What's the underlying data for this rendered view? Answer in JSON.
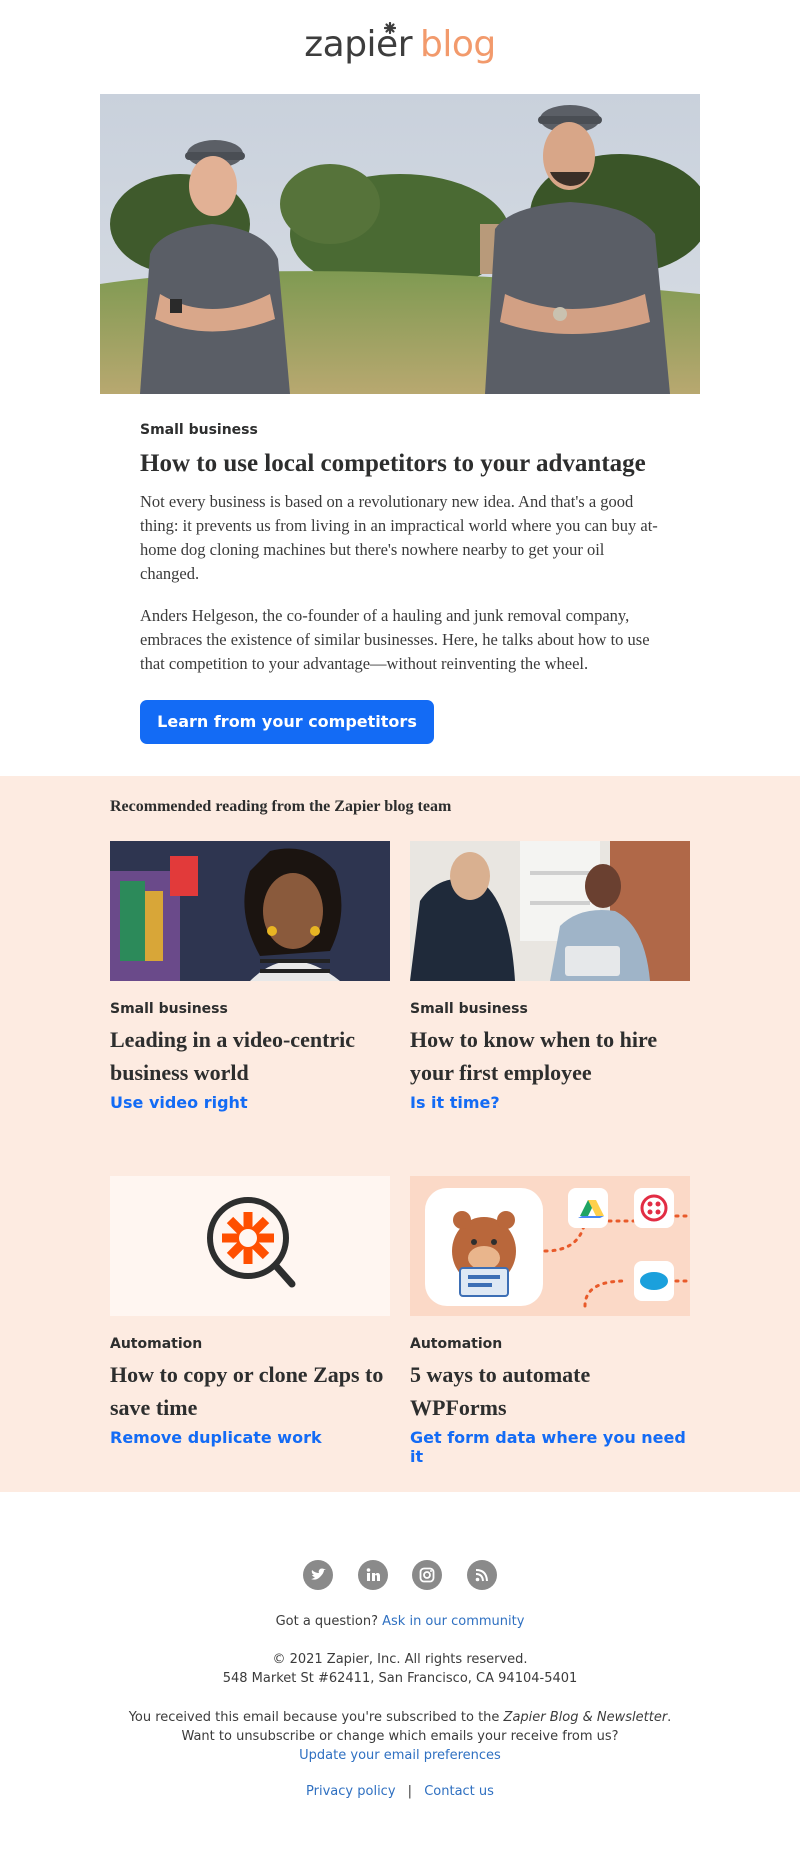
{
  "brand": {
    "name": "zapier",
    "suffix": "blog",
    "accent": "#f29a6c",
    "primary": "#136bf5"
  },
  "hero": {
    "image": "hero-photo-two-men-crossed-arms"
  },
  "article": {
    "category": "Small business",
    "title": "How to use local competitors to your advantage",
    "paragraph1": "Not every business is based on a revolutionary new idea. And that's a good thing: it prevents us from living in an impractical world where you can buy at-home dog cloning machines but there's nowhere nearby to get your oil changed.",
    "paragraph2": "Anders Helgeson, the co-founder of a hauling and junk removal company, embraces the existence of similar businesses. Here, he talks about how to use that competition to your advantage—without reinventing the wheel.",
    "cta_label": "Learn from your competitors"
  },
  "recommended": {
    "heading": "Recommended reading from the Zapier blog team",
    "cards": [
      {
        "category": "Small business",
        "title": "Leading in a video-centric business world",
        "link": "Use video right",
        "image": "video-call-woman"
      },
      {
        "category": "Small business",
        "title": "How to know when to hire your first employee",
        "link": "Is it time?",
        "image": "two-men-office-meeting"
      },
      {
        "category": "Automation",
        "title": "How to copy or clone Zaps to save time",
        "link": "Remove duplicate work",
        "image": "zapier-search-icon"
      },
      {
        "category": "Automation",
        "title": "5 ways to automate WPForms",
        "link": "Get form data where you need it",
        "image": "wpforms-integrations"
      }
    ]
  },
  "footer": {
    "social": [
      "twitter-icon",
      "linkedin-icon",
      "instagram-icon",
      "rss-icon"
    ],
    "question_text": "Got a question?",
    "question_link": "Ask in our community",
    "copyright": "© 2021 Zapier, Inc. All rights reserved.",
    "address": "548 Market St #62411, San Francisco, CA 94104-5401",
    "subscribed_prefix": "You received this email because you're subscribed to the",
    "subscribed_name": "Zapier Blog & Newsletter",
    "subscribed_suffix": ".",
    "unsubscribe_text": "Want to unsubscribe or change which emails your receive from us?",
    "preferences_link": "Update your email preferences",
    "privacy_link": "Privacy policy",
    "separator": "|",
    "contact_link": "Contact us"
  }
}
